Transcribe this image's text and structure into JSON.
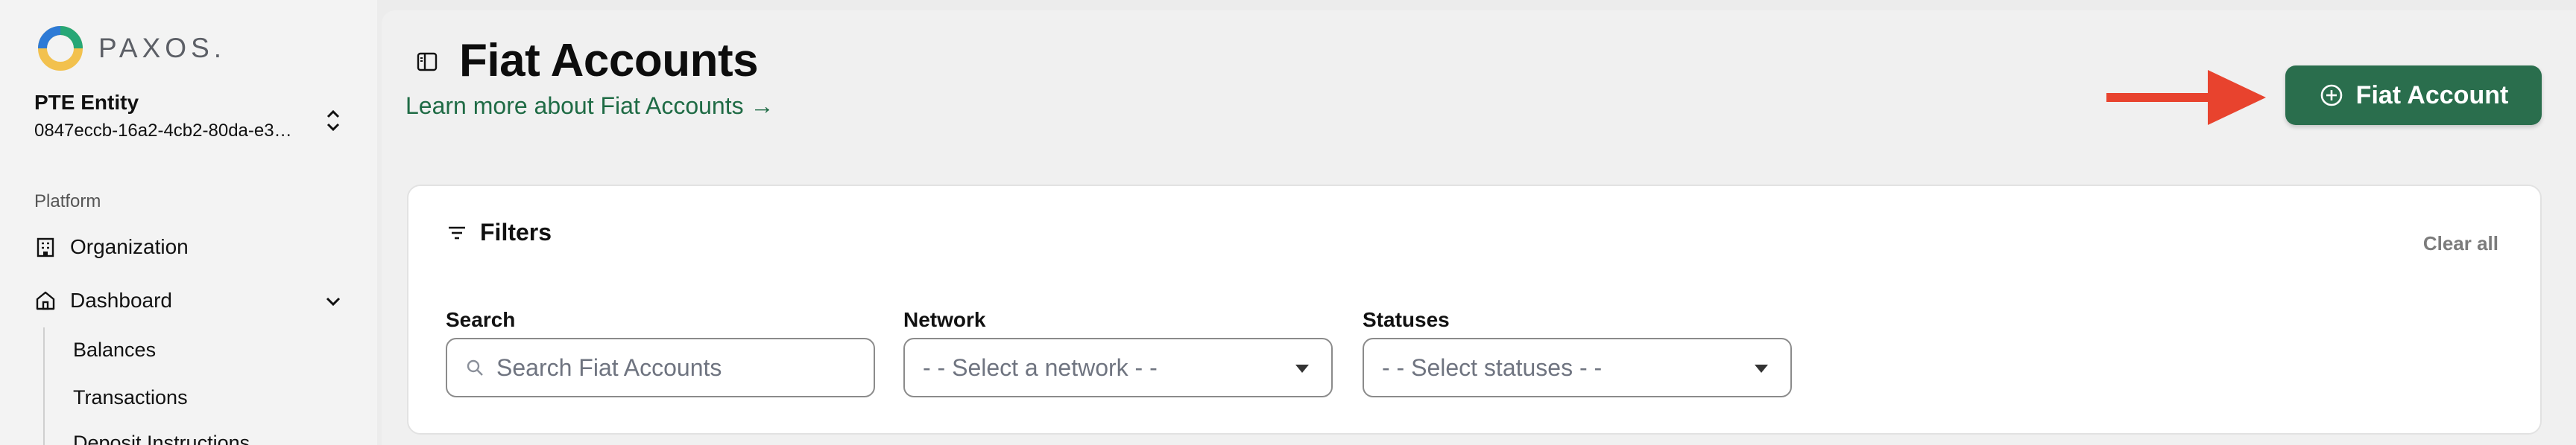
{
  "brand": {
    "name": "PAXOS."
  },
  "entity": {
    "name": "PTE Entity",
    "id": "0847eccb-16a2-4cb2-80da-e3…"
  },
  "sidebar": {
    "section_label": "Platform",
    "items": [
      {
        "label": "Organization",
        "icon": "building-icon"
      },
      {
        "label": "Dashboard",
        "icon": "home-icon",
        "expanded": true
      }
    ],
    "dashboard_children": [
      "Balances",
      "Transactions",
      "Deposit Instructions"
    ]
  },
  "header": {
    "title": "Fiat Accounts",
    "learn_more": "Learn more about Fiat Accounts →",
    "primary_button": "Fiat Account"
  },
  "filters": {
    "heading": "Filters",
    "clear_all": "Clear all",
    "search": {
      "label": "Search",
      "placeholder": "Search Fiat Accounts"
    },
    "network": {
      "label": "Network",
      "value": "- - Select a network - -"
    },
    "statuses": {
      "label": "Statuses",
      "value": "- - Select statuses - -"
    }
  },
  "colors": {
    "accent_green": "#2a6e4d",
    "link_green": "#1f6b45",
    "annotation_arrow": "#e8432e"
  }
}
